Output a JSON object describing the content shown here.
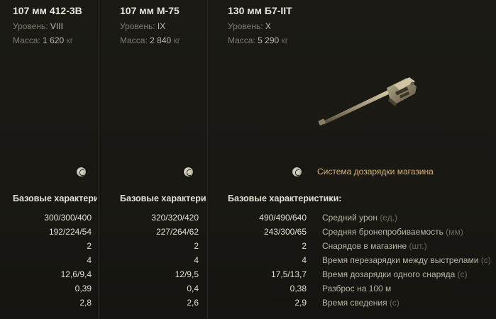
{
  "columns": [
    {
      "name": "107 мм 412-3В",
      "level_label": "Уровень:",
      "level": "VIII",
      "mass_label": "Масса:",
      "mass": "1 620",
      "mass_unit": "кг",
      "section_title": "Базовые характерис",
      "values": [
        "300/300/400",
        "192/224/54",
        "2",
        "4",
        "12,6/9,4",
        "0,39",
        "2,8"
      ]
    },
    {
      "name": "107 мм М-75",
      "level_label": "Уровень:",
      "level": "IX",
      "mass_label": "Масса:",
      "mass": "2 840",
      "mass_unit": "кг",
      "section_title": "Базовые характерис",
      "values": [
        "320/320/420",
        "227/264/62",
        "2",
        "4",
        "12/9,5",
        "0,4",
        "2,6"
      ]
    },
    {
      "name": "130 мм Б7-IIТ",
      "level_label": "Уровень:",
      "level": "X",
      "mass_label": "Масса:",
      "mass": "5 290",
      "mass_unit": "кг",
      "special_system": "Система дозарядки магазина",
      "section_title": "Базовые характеристики:",
      "values": [
        "490/490/640",
        "243/300/65",
        "2",
        "4",
        "17,5/13,7",
        "0,38",
        "2,9"
      ]
    }
  ],
  "stat_labels": [
    {
      "label": "Средний урон",
      "unit": "(ед.)"
    },
    {
      "label": "Средняя бронепробиваемость",
      "unit": "(мм)"
    },
    {
      "label": "Снарядов в магазине",
      "unit": "(шт.)"
    },
    {
      "label": "Время перезарядки между выстрелами",
      "unit": "(с)"
    },
    {
      "label": "Время дозарядки одного снаряда",
      "unit": "(с)"
    },
    {
      "label": "Разброс на 100 м",
      "unit": ""
    },
    {
      "label": "Время сведения",
      "unit": "(с)"
    }
  ],
  "icons": {
    "special_icon": "magazine-reload-icon",
    "gun_image": "gun-model-image"
  }
}
